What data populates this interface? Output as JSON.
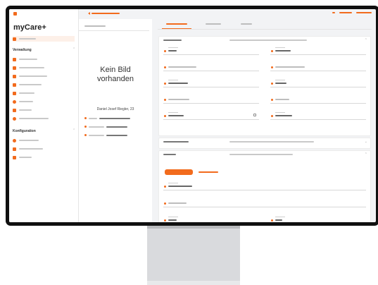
{
  "app": {
    "title": "myCare+"
  },
  "profile": {
    "image_placeholder_line1": "Kein Bild",
    "image_placeholder_line2": "vorhanden",
    "full_name": "Daniel Josef Riegler, 23"
  },
  "sidebar": {
    "sections": [
      {
        "heading": "",
        "items": [
          {
            "icon": "home-icon"
          }
        ]
      },
      {
        "heading": "Verwaltung",
        "items": [
          {
            "icon": "person-icon"
          },
          {
            "icon": "person-icon"
          },
          {
            "icon": "group-icon"
          },
          {
            "icon": "medkit-icon"
          },
          {
            "icon": "document-icon"
          },
          {
            "icon": "cloud-icon"
          },
          {
            "icon": "calendar-icon"
          },
          {
            "icon": "chart-icon"
          }
        ]
      },
      {
        "heading": "Konfiguration",
        "items": [
          {
            "icon": "gear-icon"
          },
          {
            "icon": "flag-icon"
          },
          {
            "icon": "filter-icon"
          }
        ]
      }
    ]
  },
  "colors": {
    "accent": "#f26b1d",
    "background": "#f2f3f5",
    "panel": "#ffffff"
  }
}
